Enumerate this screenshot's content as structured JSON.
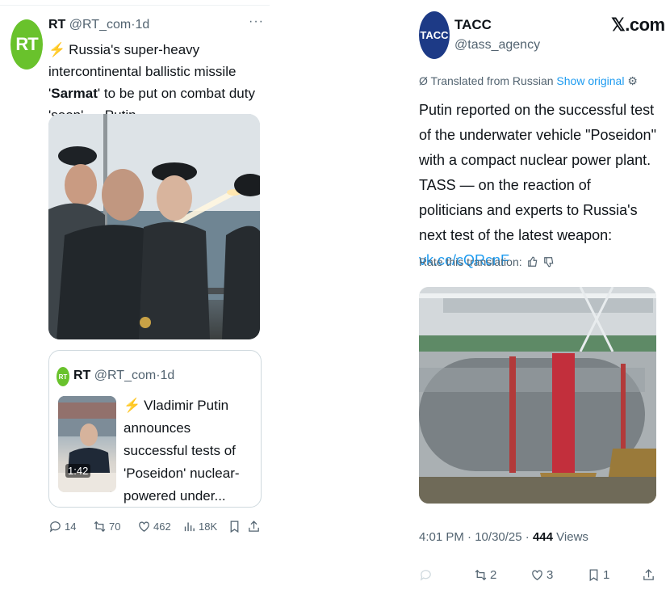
{
  "left_tweet": {
    "avatar_text": "RT",
    "name": "RT",
    "handle": "@RT_com",
    "time": "1d",
    "more": "···",
    "text_part1": "Russia's super-heavy intercontinental ballistic missile '",
    "text_bold": "Sarmat",
    "text_part2": "' to be put on combat duty 'soon' — Putin",
    "quote": {
      "avatar_text": "RT",
      "name": "RT",
      "handle": "@RT_com",
      "time": "1d",
      "duration": "1:42",
      "text": "Vladimir Putin announces successful tests of 'Poseidon' nuclear-powered under..."
    },
    "actions": {
      "replies": "14",
      "reposts": "70",
      "likes": "462",
      "views": "18K"
    }
  },
  "right_tweet": {
    "avatar_text": "TACC",
    "name": "TACC",
    "handle": "@tass_agency",
    "brand": "𝕏.com",
    "translated_label": "Translated from Russian",
    "show_original": "Show original",
    "text": "Putin reported on the successful test of the underwater vehicle \"Poseidon\" with a compact nuclear power plant. TASS — on the reaction of politicians and experts to Russia's next test of the latest weapon:",
    "link": "vk.cc/cQRcnF",
    "rate_label": "Rate this translation:",
    "time": "4:01 PM",
    "date": "10/30/25",
    "views_count": "444",
    "views_label": "Views",
    "actions": {
      "reposts": "2",
      "likes": "3",
      "bookmarks": "1"
    }
  },
  "colors": {
    "rt_green": "#69c22c",
    "tass_blue": "#1d3a86",
    "link_blue": "#1d9bf0",
    "muted": "#536471"
  }
}
